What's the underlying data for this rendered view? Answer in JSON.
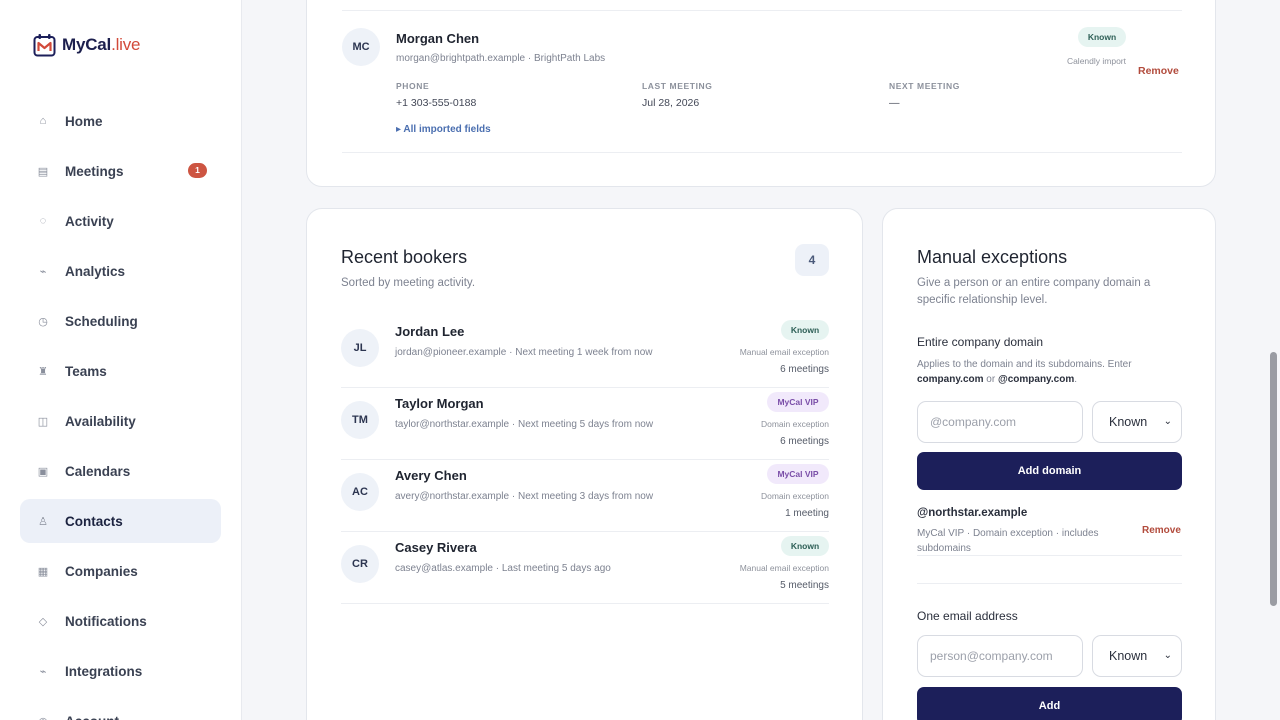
{
  "brand": {
    "name": "MyCal",
    "suffix": ".live"
  },
  "sidebar": {
    "items": [
      {
        "label": "Home",
        "icon": "home-icon",
        "glyph": "⌂"
      },
      {
        "label": "Meetings",
        "icon": "meetings-icon",
        "glyph": "▤",
        "badge": "1"
      },
      {
        "label": "Activity",
        "icon": "activity-icon",
        "glyph": "◌"
      },
      {
        "label": "Analytics",
        "icon": "analytics-icon",
        "glyph": "⌁"
      },
      {
        "label": "Scheduling",
        "icon": "clock-icon",
        "glyph": "◷"
      },
      {
        "label": "Teams",
        "icon": "teams-icon",
        "glyph": "♜"
      },
      {
        "label": "Availability",
        "icon": "availability-icon",
        "glyph": "◫"
      },
      {
        "label": "Calendars",
        "icon": "calendar-icon",
        "glyph": "▣"
      },
      {
        "label": "Contacts",
        "icon": "contacts-icon",
        "glyph": "♙",
        "active": true
      },
      {
        "label": "Companies",
        "icon": "companies-icon",
        "glyph": "▦"
      },
      {
        "label": "Notifications",
        "icon": "notifications-icon",
        "glyph": "◇"
      },
      {
        "label": "Integrations",
        "icon": "integrations-icon",
        "glyph": "⌁"
      },
      {
        "label": "Account",
        "icon": "account-icon",
        "glyph": "◉"
      }
    ]
  },
  "top_contact": {
    "initials": "MC",
    "name": "Morgan Chen",
    "subtitle": "morgan@brightpath.example · BrightPath Labs",
    "badge": "Known",
    "source": "Calendly import",
    "remove": "Remove",
    "phone_label": "PHONE",
    "phone": "+1 303-555-0188",
    "last_label": "LAST MEETING",
    "last": "Jul 28, 2026",
    "next_label": "NEXT MEETING",
    "next": "—",
    "fields_link": "▸ All imported fields"
  },
  "bookers": {
    "title": "Recent bookers",
    "subtitle": "Sorted by meeting activity.",
    "count": "4",
    "rows": [
      {
        "initials": "JL",
        "name": "Jordan Lee",
        "sub": "jordan@pioneer.example · Next meeting 1 week from now",
        "badge": "Known",
        "badge_type": "known",
        "source": "Manual email exception",
        "meetings": "6 meetings"
      },
      {
        "initials": "TM",
        "name": "Taylor Morgan",
        "sub": "taylor@northstar.example · Next meeting 5 days from now",
        "badge": "MyCal VIP",
        "badge_type": "vip",
        "source": "Domain exception",
        "meetings": "6 meetings"
      },
      {
        "initials": "AC",
        "name": "Avery Chen",
        "sub": "avery@northstar.example · Next meeting 3 days from now",
        "badge": "MyCal VIP",
        "badge_type": "vip",
        "source": "Domain exception",
        "meetings": "1 meeting"
      },
      {
        "initials": "CR",
        "name": "Casey Rivera",
        "sub": "casey@atlas.example · Last meeting 5 days ago",
        "badge": "Known",
        "badge_type": "known",
        "source": "Manual email exception",
        "meetings": "5 meetings"
      }
    ]
  },
  "exceptions": {
    "title": "Manual exceptions",
    "description": "Give a person or an entire company domain a specific relationship level.",
    "domain_heading": "Entire company domain",
    "domain_help_prefix": "Applies to the domain and its subdomains. Enter",
    "domain_help_ex1": "company.com",
    "domain_help_or": "or",
    "domain_help_ex2": "@company.com",
    "domain_placeholder": "@company.com",
    "domain_level": "Known",
    "add_domain": "Add domain",
    "existing_domain": "@northstar.example",
    "existing_domain_sub": "MyCal VIP · Domain exception · includes subdomains",
    "existing_remove": "Remove",
    "email_heading": "One email address",
    "email_placeholder": "person@company.com",
    "email_level": "Known",
    "add_email": "Add"
  },
  "colors": {
    "brand_navy": "#1c1f5a",
    "brand_red": "#d24a3a",
    "known_badge": "#e6f4f1",
    "vip_badge": "#f1e9fb"
  }
}
